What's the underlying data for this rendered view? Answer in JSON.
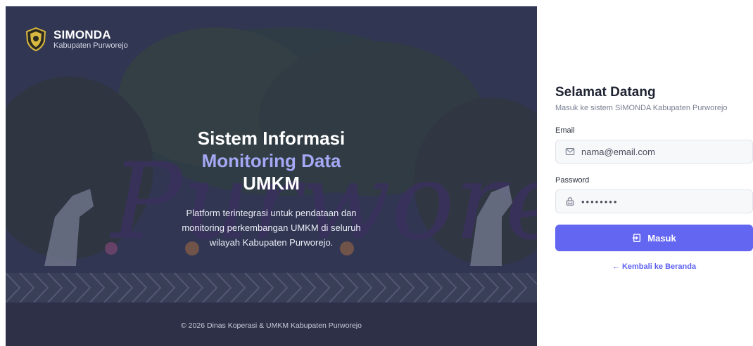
{
  "brand": {
    "name": "SIMONDA",
    "region": "Kabupaten Purworejo"
  },
  "hero": {
    "title_line1": "Sistem Informasi",
    "title_line2": "Monitoring Data",
    "title_line3": "UMKM",
    "description": "Platform terintegrasi untuk pendataan dan monitoring perkembangan UMKM di seluruh wilayah Kabupaten Purworejo.",
    "footer": "© 2026 Dinas Koperasi & UMKM Kabupaten Purworejo",
    "sign_text": "Purworejo"
  },
  "login": {
    "title": "Selamat Datang",
    "subtitle": "Masuk ke sistem SIMONDA Kabupaten Purworejo",
    "email_label": "Email",
    "email_placeholder": "nama@email.com",
    "password_label": "Password",
    "password_value": "••••••••",
    "submit_label": "Masuk",
    "back_label": "Kembali ke Beranda"
  },
  "colors": {
    "accent": "#6366f1",
    "accent_light": "#a5a8f5",
    "title": "#1f2433"
  },
  "icons": {
    "email": "mail-icon",
    "password": "lock-icon",
    "submit": "login-icon",
    "back": "arrow-left-icon"
  }
}
